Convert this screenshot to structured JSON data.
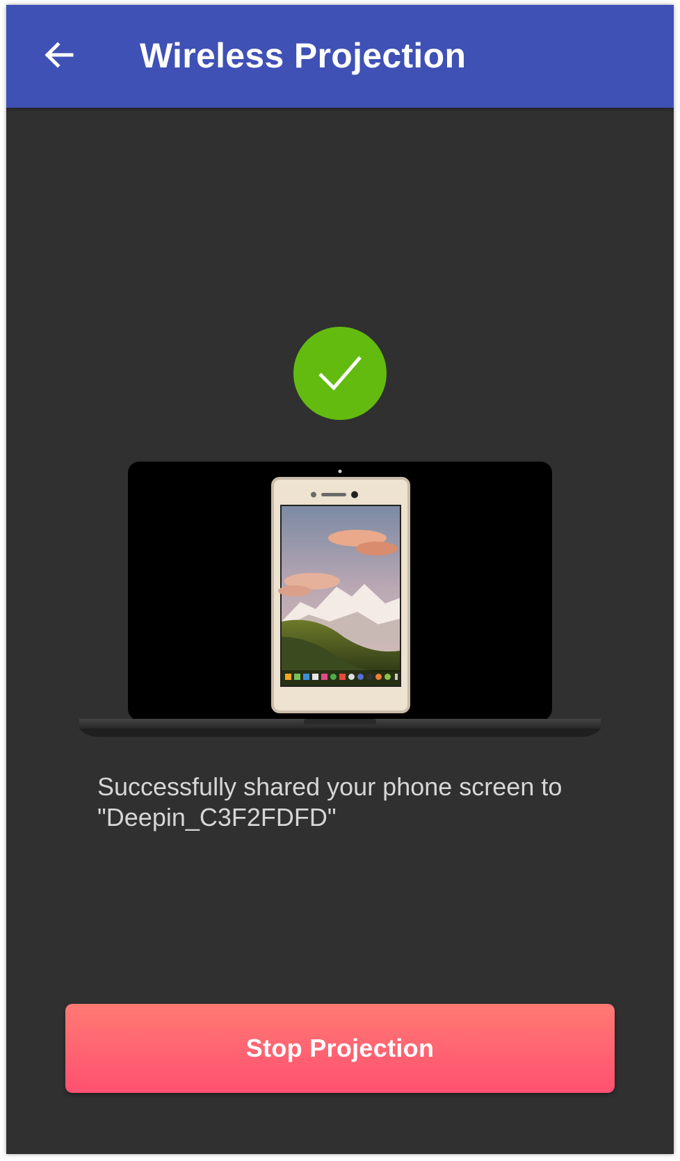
{
  "app_bar": {
    "back_icon": "arrow-left-icon",
    "title": "Wireless Projection",
    "background_color": "#3f51b5"
  },
  "status": {
    "icon": "check-circle-icon",
    "icon_color": "#64bb0f",
    "illustration": "laptop-with-phone-illustration",
    "message": "Successfully shared your phone screen to\n \"Deepin_C3F2FDFD\""
  },
  "actions": {
    "stop_label": "Stop Projection",
    "stop_color_top": "#ff7a73",
    "stop_color_bottom": "#ff5070"
  },
  "colors": {
    "background": "#303030",
    "message_text": "#d6d6d6"
  }
}
